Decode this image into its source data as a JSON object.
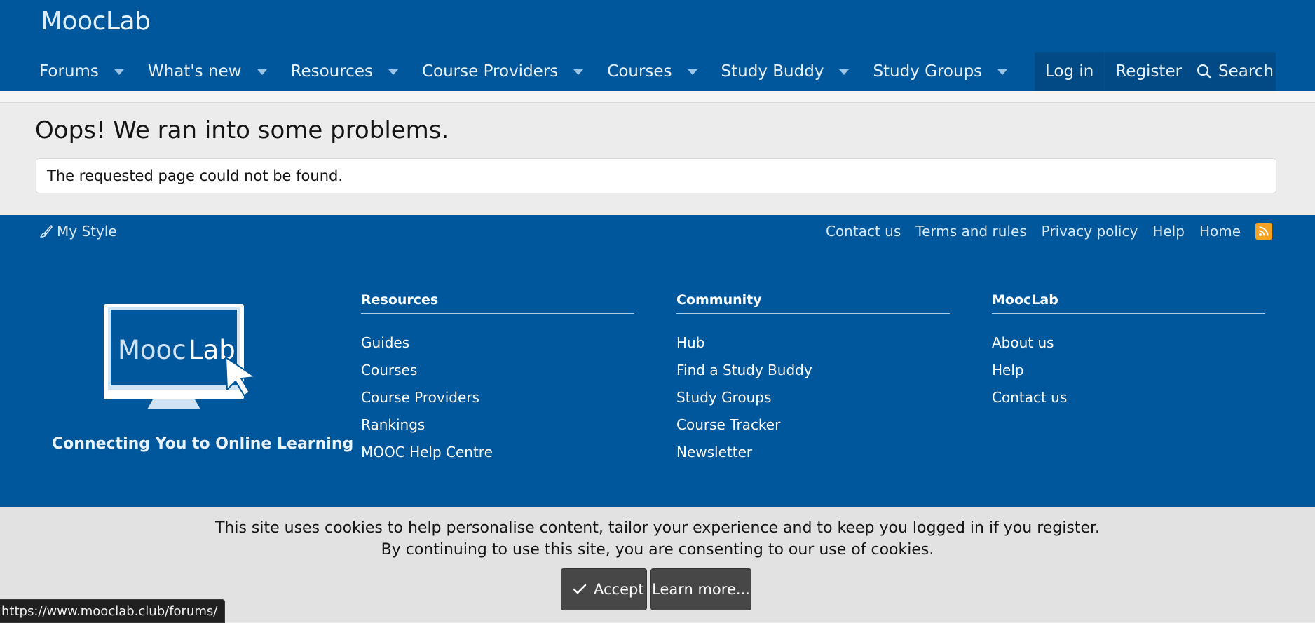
{
  "header": {
    "logo": {
      "part1": "Mooc",
      "part2": "Lab"
    },
    "nav": [
      {
        "label": "Forums"
      },
      {
        "label": "What's new"
      },
      {
        "label": "Resources"
      },
      {
        "label": "Course Providers"
      },
      {
        "label": "Courses"
      },
      {
        "label": "Study Buddy"
      },
      {
        "label": "Study Groups"
      }
    ],
    "login_label": "Log in",
    "register_label": "Register",
    "search_label": "Search"
  },
  "main": {
    "title": "Oops! We ran into some problems.",
    "message": "The requested page could not be found."
  },
  "footer": {
    "my_style": "My Style",
    "links": [
      "Contact us",
      "Terms and rules",
      "Privacy policy",
      "Help",
      "Home"
    ],
    "logo_text": {
      "part1": "Mooc",
      "part2": "Lab"
    },
    "tagline": "Connecting You to Online Learning",
    "columns": [
      {
        "heading": "Resources",
        "items": [
          "Guides",
          "Courses",
          "Course Providers",
          "Rankings",
          "MOOC Help Centre"
        ]
      },
      {
        "heading": "Community",
        "items": [
          "Hub",
          "Find a Study Buddy",
          "Study Groups",
          "Course Tracker",
          "Newsletter"
        ]
      },
      {
        "heading": "MoocLab",
        "items": [
          "About us",
          "Help",
          "Contact us"
        ]
      }
    ]
  },
  "cookie": {
    "line1": "This site uses cookies to help personalise content, tailor your experience and to keep you logged in if you register.",
    "line2": "By continuing to use this site, you are consenting to our use of cookies.",
    "accept_label": "Accept",
    "learn_label": "Learn more..."
  },
  "status_url": "https://www.mooclab.club/forums/",
  "colors": {
    "brand": "#01579b",
    "rss": "#f4a21f"
  }
}
